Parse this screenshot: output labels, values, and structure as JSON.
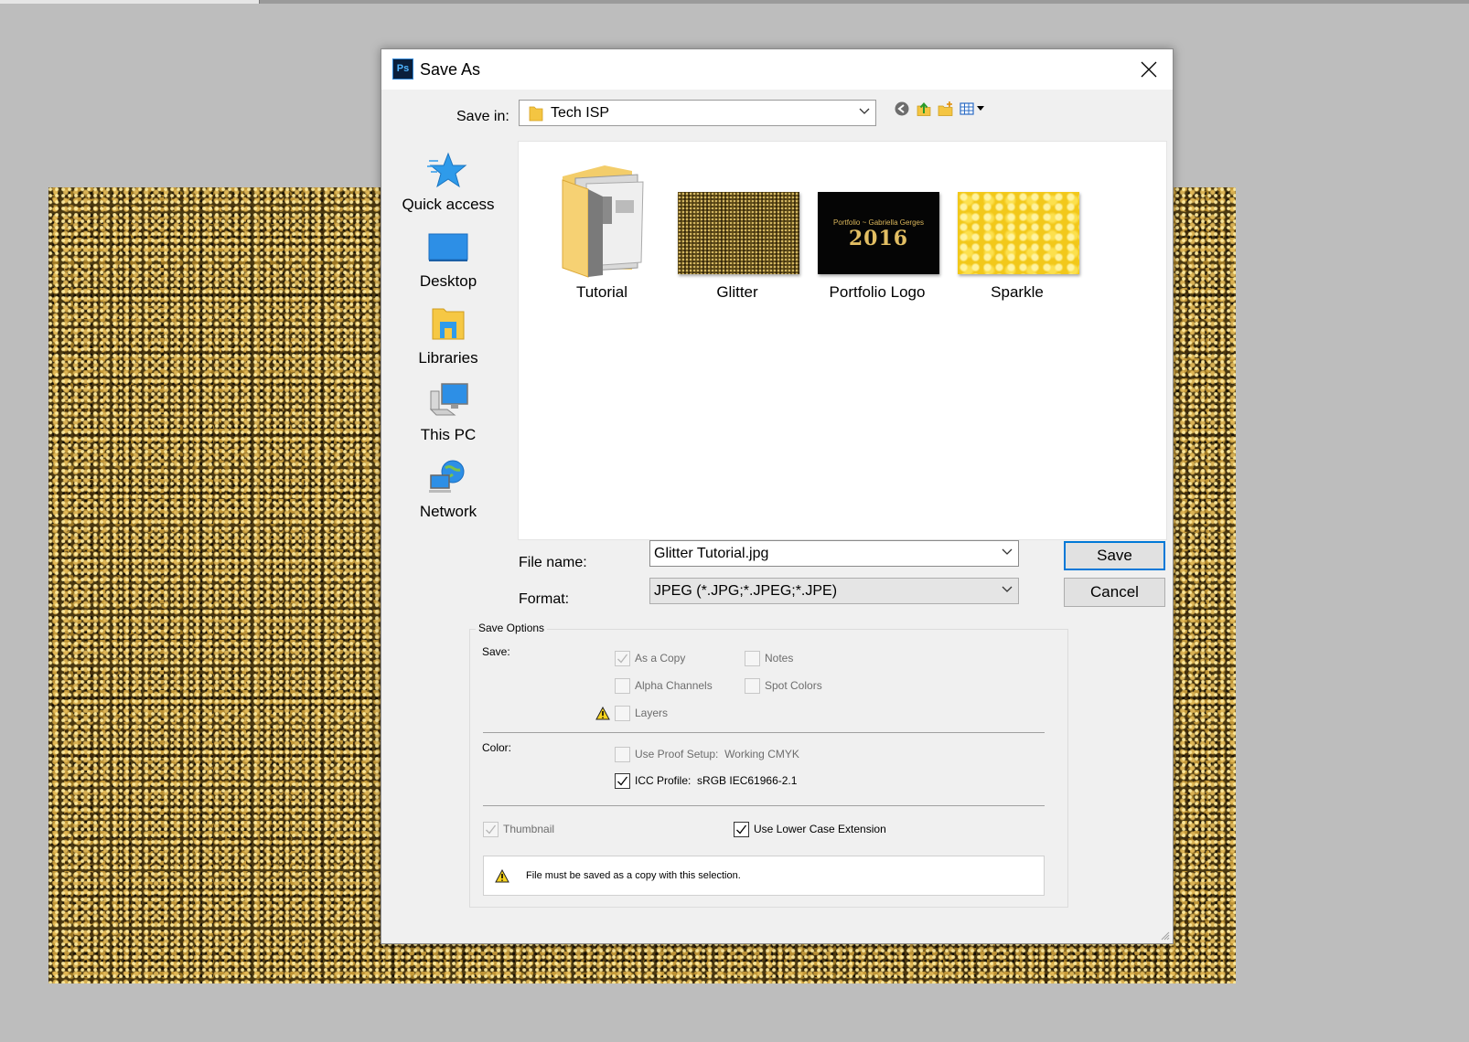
{
  "dialog": {
    "title": "Save As",
    "app_icon": "Ps",
    "save_in_label": "Save in:",
    "save_in_value": "Tech ISP"
  },
  "places": [
    {
      "label": "Quick access",
      "icon": "quick-access-star-icon"
    },
    {
      "label": "Desktop",
      "icon": "desktop-icon"
    },
    {
      "label": "Libraries",
      "icon": "libraries-icon"
    },
    {
      "label": "This PC",
      "icon": "computer-icon"
    },
    {
      "label": "Network",
      "icon": "network-icon"
    }
  ],
  "files": [
    {
      "name": "Tutorial",
      "kind": "folder"
    },
    {
      "name": "Glitter",
      "kind": "image"
    },
    {
      "name": "Portfolio Logo",
      "kind": "image",
      "thumb_small_text": "Portfolio ~ Gabriella Gerges",
      "thumb_big_text": "2016"
    },
    {
      "name": "Sparkle",
      "kind": "image"
    }
  ],
  "file_name": {
    "label": "File name:",
    "value": "Glitter Tutorial.jpg"
  },
  "format": {
    "label": "Format:",
    "value": "JPEG (*.JPG;*.JPEG;*.JPE)"
  },
  "buttons": {
    "save": "Save",
    "cancel": "Cancel"
  },
  "save_options": {
    "legend": "Save Options",
    "save_label": "Save:",
    "as_a_copy": "As a Copy",
    "notes": "Notes",
    "alpha_channels": "Alpha Channels",
    "spot_colors": "Spot Colors",
    "layers": "Layers",
    "color_label": "Color:",
    "use_proof_setup": "Use Proof Setup:",
    "proof_value": "Working CMYK",
    "icc_profile": "ICC Profile:",
    "icc_value": "sRGB IEC61966-2.1",
    "thumbnail": "Thumbnail",
    "lower_case_ext": "Use Lower Case Extension",
    "warning": "File must be saved as a copy with this selection."
  },
  "colors": {
    "dialog_bg": "#f0f0f0",
    "accent": "#0078d7",
    "canvas_bg": "#bdbdbd",
    "glitter_gold": "#4a3810"
  }
}
